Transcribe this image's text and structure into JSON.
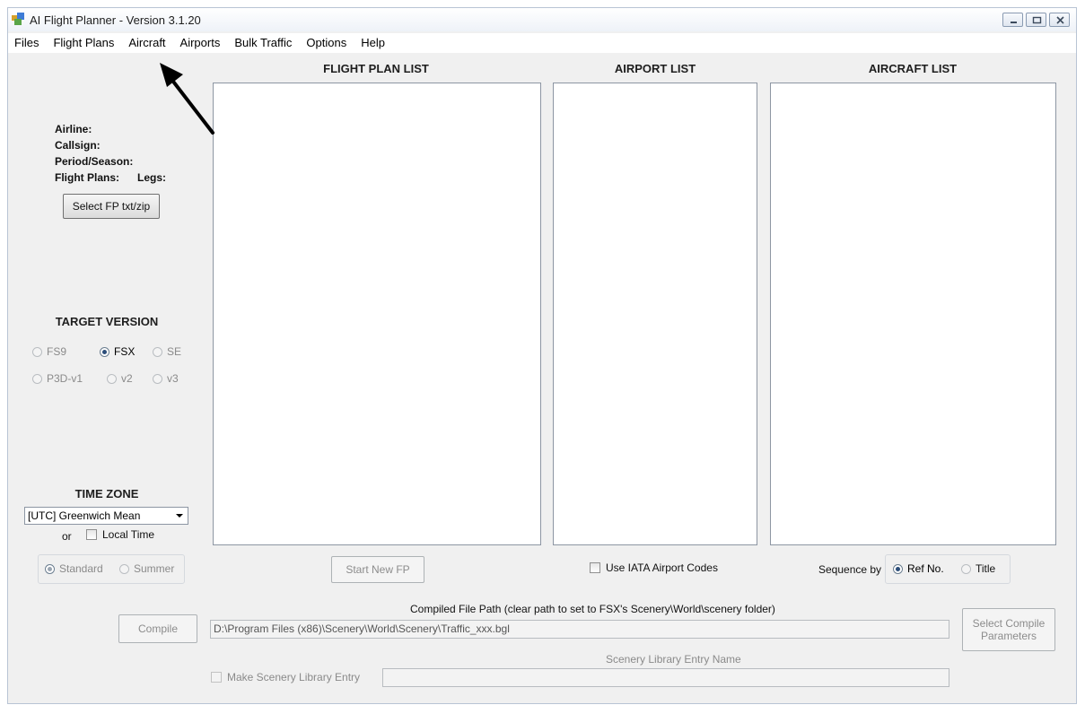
{
  "window": {
    "title": "AI Flight Planner - Version 3.1.20",
    "controls": {
      "minimize": "minimize-icon",
      "maximize": "maximize-icon",
      "close": "close-icon"
    }
  },
  "menu": [
    "Files",
    "Flight Plans",
    "Aircraft",
    "Airports",
    "Bulk Traffic",
    "Options",
    "Help"
  ],
  "lists": {
    "flight_plan": "FLIGHT PLAN LIST",
    "airport": "AIRPORT LIST",
    "aircraft": "AIRCRAFT LIST"
  },
  "info": {
    "airline": "Airline:",
    "callsign": "Callsign:",
    "period": "Period/Season:",
    "flight_plans": "Flight Plans:",
    "legs": "Legs:"
  },
  "select_fp": "Select FP txt/zip",
  "target_version": {
    "title": "TARGET VERSION",
    "options": [
      "FS9",
      "FSX",
      "SE",
      "P3D-v1",
      "v2",
      "v3"
    ],
    "selected": "FSX"
  },
  "time_zone": {
    "title": "TIME ZONE",
    "selected": "[UTC] Greenwich Mean",
    "or": "or",
    "local_time": "Local Time",
    "standard": "Standard",
    "summer": "Summer"
  },
  "start_new_fp": "Start New FP",
  "use_iata": "Use IATA Airport Codes",
  "sequence": {
    "label": "Sequence by",
    "ref_no": "Ref No.",
    "title": "Title",
    "selected": "Ref No."
  },
  "compile": {
    "button": "Compile",
    "path_label": "Compiled File Path (clear path to set to FSX's Scenery\\World\\scenery folder)",
    "path_value": "D:\\Program Files (x86)\\Scenery\\World\\Scenery\\Traffic_xxx.bgl",
    "params_button": "Select Compile Parameters",
    "library_label": "Scenery Library Entry Name",
    "make_entry": "Make Scenery Library Entry"
  },
  "colors": {
    "window_bg": "#f0f0f0",
    "list_bg": "#ffffff",
    "radio_dot": "#2b4d79"
  }
}
